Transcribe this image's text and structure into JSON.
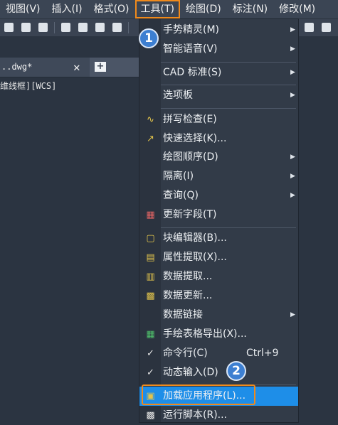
{
  "menubar": {
    "items": [
      "视图(V)",
      "插入(I)",
      "格式(O)",
      "工具(T)",
      "绘图(D)",
      "标注(N)",
      "修改(M)"
    ],
    "active_index": 3
  },
  "tab": {
    "title": "..dwg*",
    "close": "✕",
    "new": "+"
  },
  "viewport": {
    "label": "维线框][WCS]"
  },
  "menu": {
    "items": [
      {
        "label": "手势精灵(M)",
        "submenu": true
      },
      {
        "label": "智能语音(V)",
        "submenu": true
      },
      {
        "label": "CAD 标准(S)",
        "submenu": true
      },
      {
        "label": "选项板",
        "submenu": true
      },
      {
        "label": "拼写检查(E)"
      },
      {
        "label": "快速选择(K)..."
      },
      {
        "label": "绘图顺序(D)",
        "submenu": true
      },
      {
        "label": "隔离(I)",
        "submenu": true
      },
      {
        "label": "查询(Q)",
        "submenu": true
      },
      {
        "label": "更新字段(T)"
      },
      {
        "label": "块编辑器(B)..."
      },
      {
        "label": "属性提取(X)..."
      },
      {
        "label": "数据提取..."
      },
      {
        "label": "数据更新..."
      },
      {
        "label": "数据链接",
        "submenu": true
      },
      {
        "label": "手绘表格导出(X)..."
      },
      {
        "label": "命令行(C)",
        "shortcut": "Ctrl+9",
        "checked": true
      },
      {
        "label": "动态输入(D)",
        "checked": true
      },
      {
        "label": "加载应用程序(L)...",
        "highlighted": true
      },
      {
        "label": "运行脚本(R)..."
      }
    ]
  },
  "badges": {
    "one": "1",
    "two": "2"
  },
  "colors": {
    "highlight": "#1e8ee8",
    "callout_border": "#f08a1c",
    "badge": "#3d7fd1"
  }
}
